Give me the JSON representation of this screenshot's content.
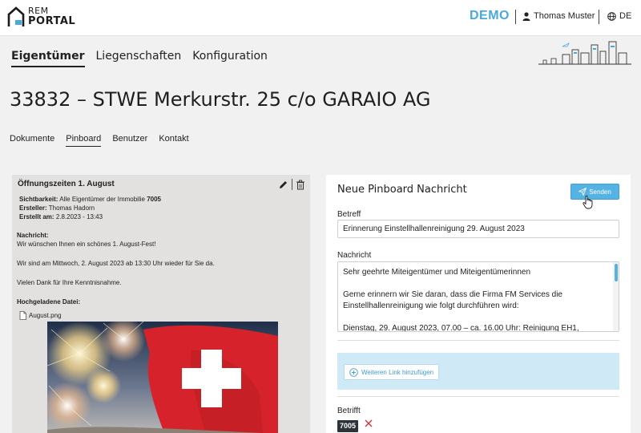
{
  "header": {
    "logo_line1": "REM",
    "logo_line2": "PORTAL",
    "env_badge": "DEMO",
    "user_name": "Thomas Muster",
    "language": "DE",
    "colors": {
      "accent": "#49a9dd",
      "button": "#55b3e3"
    }
  },
  "main_nav": {
    "items": [
      "Eigentümer",
      "Liegenschaften",
      "Konfiguration"
    ],
    "active": "Eigentümer"
  },
  "page": {
    "title": "33832 – STWE Merkurstr. 25 c/o GARAIO AG"
  },
  "sub_nav": {
    "items": [
      "Dokumente",
      "Pinboard",
      "Benutzer",
      "Kontakt"
    ],
    "active": "Pinboard"
  },
  "post": {
    "title": "Öffnungszeiten 1. August",
    "visibility_label": "Sichtbarkeit:",
    "visibility_text": "Alle Eigentümer der Immobilie",
    "visibility_id": "7005",
    "author_label": "Ersteller:",
    "author": "Thomas Hadorn",
    "created_label": "Erstellt am:",
    "created": "2.8.2023 - 13:43",
    "message_label": "Nachricht:",
    "message_lines": [
      "Wir wünschen Ihnen ein schönes 1. August-Fest!",
      "Wir sind am Mittwoch, 2. August 2023 ab 13:30 Uhr wieder für Sie da.",
      "Vielen Dank für Ihre Kenntnisnahme."
    ],
    "upload_label": "Hochgeladene Datei:",
    "file_name": "August.png",
    "icons": [
      "pencil-icon",
      "trash-icon",
      "file-icon"
    ]
  },
  "form": {
    "title": "Neue Pinboard Nachricht",
    "send_label": "Senden",
    "subject_label": "Betreff",
    "subject_value": "Erinnerung Einstellhallenreinigung 29. August 2023",
    "message_label": "Nachricht",
    "message_lines": [
      "Sehr geehrte Miteigentümer und Miteigentümerinnen",
      "Gerne erinnern wir Sie daran, dass die Firma FM Services die Einstellhallenreinigung wie folgt durchführen wird:",
      "Dienstag, 29. August 2023, 07.00 – ca. 16.00 Uhr: Reinigung EH1,"
    ],
    "add_link_label": "Weiteren Link hinzufügen",
    "concerns_label": "Betrifft",
    "concerns_tag": "7005"
  }
}
